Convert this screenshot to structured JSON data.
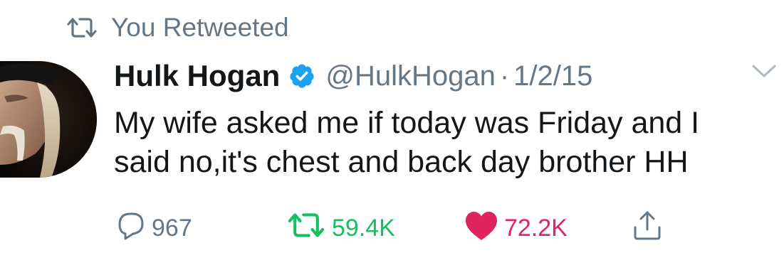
{
  "retweet_context": {
    "label": "You Retweeted",
    "icon": "retweet-icon"
  },
  "tweet": {
    "author_name": "Hulk Hogan",
    "verified": true,
    "handle": "@HulkHogan",
    "separator": "·",
    "date": "1/2/15",
    "text_lines": [
      "My wife asked me if today was Friday and I",
      "said no,it's chest and back day brother HH"
    ],
    "avatar": {
      "icon": "avatar"
    }
  },
  "actions": {
    "reply_count": "967",
    "retweet_count": "59.4K",
    "like_count": "72.2K"
  },
  "colors": {
    "muted": "#657786",
    "retweet_green": "#17bf63",
    "like_red": "#e0245e",
    "verified_blue": "#1da1f2"
  }
}
